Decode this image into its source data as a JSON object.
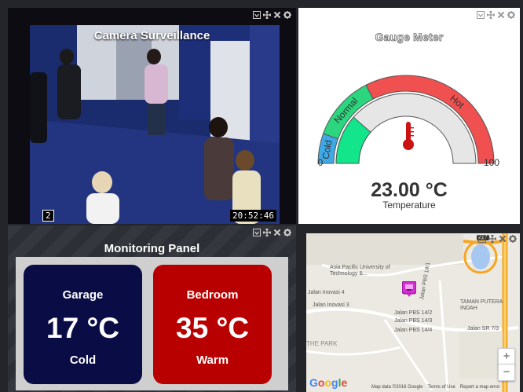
{
  "camera": {
    "title": "Camera Surveillance",
    "timestamp": "20:52:46",
    "channel": "2"
  },
  "gauge": {
    "title": "Gauge Meter",
    "value": "23.00 °C",
    "label": "Temperature",
    "min": "0",
    "max": "100",
    "zones": [
      "Cold",
      "Normal",
      "Hot"
    ],
    "level": 23
  },
  "monitoring": {
    "title": "Monitoring Panel",
    "tiles": [
      {
        "name": "Garage",
        "value": "17 °C",
        "status": "Cold",
        "color": "#0a0c45"
      },
      {
        "name": "Bedroom",
        "value": "35 °C",
        "status": "Warm",
        "color": "#b90000"
      }
    ]
  },
  "map": {
    "labels": {
      "university": "Asia Pacific University of Technology &...",
      "inovasi4": "Jalan Inovasi 4",
      "inovasi3": "Jalan Inovasi 3",
      "pbs141": "Jalan PBS 14/1",
      "pbs142": "Jalan PBS 14/2",
      "pbs143": "Jalan PBS 14/3",
      "pbs144": "Jalan PBS 14/4",
      "taman": "TAMAN PUTERA INDAH",
      "sr73": "Jalan SR 7/3",
      "park": "THE PARK",
      "route": "217"
    },
    "google": "Google",
    "map_data": "Map data ©2016 Google",
    "terms": "Terms of Use",
    "report": "Report a map error",
    "zoom_in": "+",
    "zoom_out": "−"
  }
}
